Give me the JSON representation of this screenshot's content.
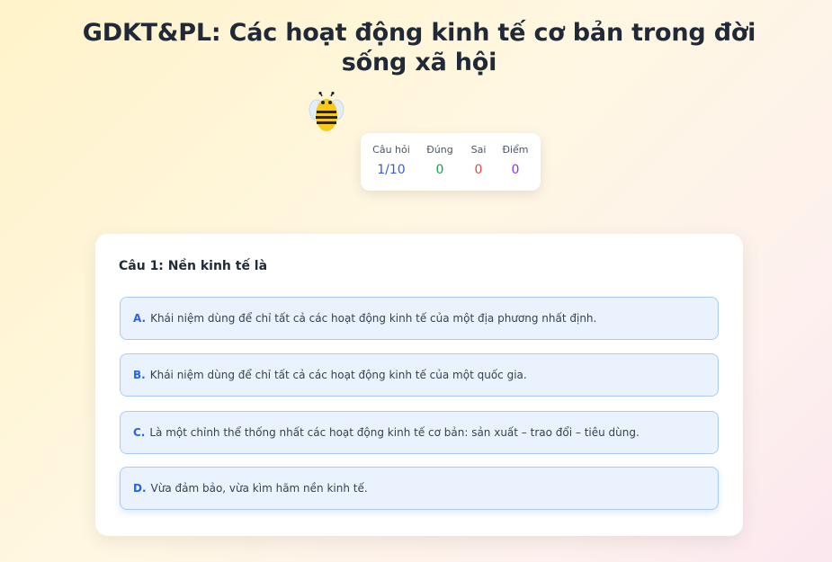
{
  "quiz": {
    "title": "GDKT&PL: Các hoạt động kinh tế cơ bản trong đời sống xã hội"
  },
  "mascot": {
    "icon": "bee-icon"
  },
  "stats": {
    "question_label": "Câu hỏi",
    "question_value": "1/10",
    "correct_label": "Đúng",
    "correct_value": "0",
    "wrong_label": "Sai",
    "wrong_value": "0",
    "score_label": "Điểm",
    "score_value": "0"
  },
  "question": {
    "text": "Câu 1: Nền kinh tế là",
    "options": [
      {
        "letter": "A.",
        "text": "Khái niệm dùng để chỉ tất cả các hoạt động kinh tế của một địa phương nhất định."
      },
      {
        "letter": "B.",
        "text": "Khái niệm dùng để chỉ tất cả các hoạt động kinh tế của một quốc gia."
      },
      {
        "letter": "C.",
        "text": "Là một chỉnh thể thống nhất các hoạt động kinh tế cơ bản: sản xuất – trao đổi – tiêu dùng."
      },
      {
        "letter": "D.",
        "text": "Vừa đảm bảo, vừa kìm hãm nền kinh tế."
      }
    ]
  },
  "colors": {
    "accent": "#2563eb",
    "correct": "#16a34a",
    "wrong": "#ef4444",
    "score": "#9333ea"
  }
}
